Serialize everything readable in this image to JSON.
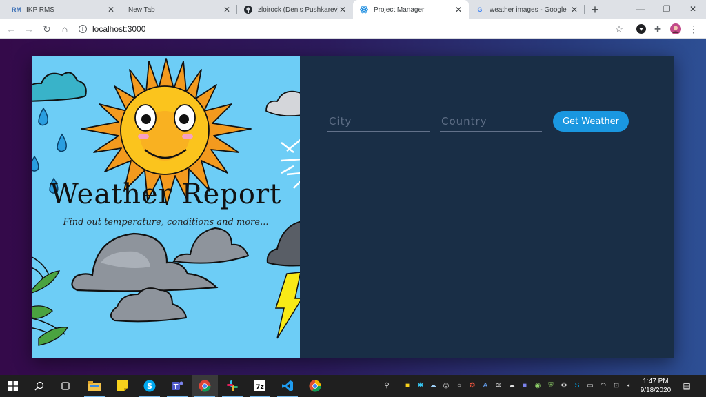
{
  "browser": {
    "tabs": [
      {
        "title": "IKP RMS",
        "favicon": "RM",
        "favicon_color": "#3b6fb6"
      },
      {
        "title": "New Tab",
        "favicon": "",
        "favicon_color": "#5f6368"
      },
      {
        "title": "zloirock (Denis Pushkarev)",
        "favicon": "●",
        "favicon_color": "#24292e"
      },
      {
        "title": "Project Manager",
        "favicon": "⚛",
        "favicon_color": "#1c8de0"
      },
      {
        "title": "weather images - Google S",
        "favicon": "G",
        "favicon_color": "#4285f4"
      }
    ],
    "active_tab": 3,
    "url": "localhost:3000"
  },
  "hero": {
    "title": "Weather Report",
    "subtitle": "Find out temperature, conditions and more..."
  },
  "form": {
    "city_placeholder": "City",
    "country_placeholder": "Country",
    "submit_label": "Get Weather"
  },
  "colors": {
    "hero_bg": "#6dcdf6",
    "form_bg": "#192e46",
    "button": "#1a97e0"
  },
  "taskbar": {
    "time": "1:47 PM",
    "date": "9/18/2020"
  }
}
